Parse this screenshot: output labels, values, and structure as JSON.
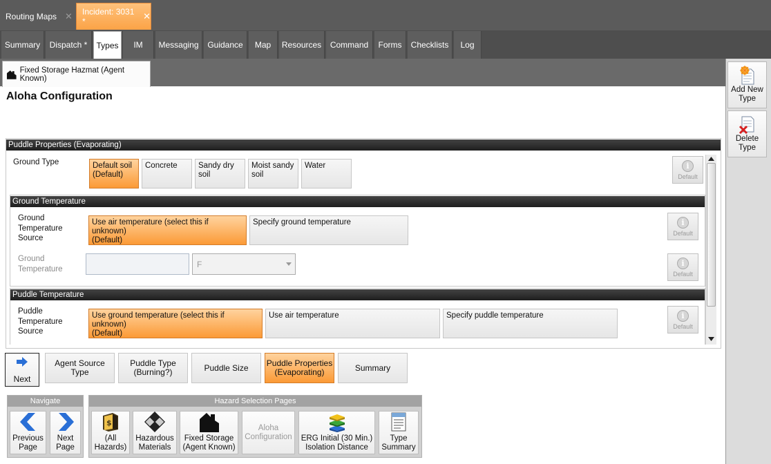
{
  "doc_tabs": [
    {
      "label": "Routing Maps",
      "close": "✕"
    },
    {
      "label": "Incident: 3031 *",
      "close": "✕"
    }
  ],
  "nav_tabs": [
    "Summary",
    "Dispatch *",
    "Types",
    "IM",
    "Messaging",
    "Guidance",
    "Map",
    "Resources",
    "Command",
    "Forms",
    "Checklists",
    "Log"
  ],
  "type_tab": {
    "label": "Fixed Storage Hazmat (Agent Known)",
    "icon": "building-icon"
  },
  "side_buttons": {
    "add": {
      "line1": "Add New",
      "line2": "Type"
    },
    "delete": {
      "line1": "Delete",
      "line2": "Type"
    }
  },
  "page_title": "Aloha Configuration",
  "puddle_section": {
    "header": "Puddle Properties (Evaporating)",
    "ground_type": {
      "label": "Ground Type",
      "options": [
        {
          "l1": "Default soil",
          "l2": "(Default)"
        },
        {
          "l1": "Concrete",
          "l2": ""
        },
        {
          "l1": "Sandy dry",
          "l2": "soil"
        },
        {
          "l1": "Moist sandy",
          "l2": "soil"
        },
        {
          "l1": "Water",
          "l2": ""
        }
      ],
      "default_label": "Default"
    }
  },
  "ground_temp_section": {
    "header": "Ground Temperature",
    "source": {
      "label_lines": [
        "Ground",
        "Temperature",
        "Source"
      ],
      "options": [
        {
          "l1": "Use air temperature (select this if unknown)",
          "l2": "(Default)"
        },
        {
          "l1": "Specify ground temperature",
          "l2": ""
        }
      ],
      "default_label": "Default"
    },
    "temperature": {
      "label_lines": [
        "Ground",
        "Temperature"
      ],
      "value": "",
      "unit": "F",
      "default_label": "Default"
    }
  },
  "puddle_temp_section": {
    "header": "Puddle Temperature",
    "source": {
      "label_lines": [
        "Puddle",
        "Temperature",
        "Source"
      ],
      "options": [
        {
          "l1": "Use ground temperature (select this if unknown)",
          "l2": "(Default)"
        },
        {
          "l1": "Use air temperature",
          "l2": ""
        },
        {
          "l1": "Specify puddle temperature",
          "l2": ""
        }
      ],
      "default_label": "Default"
    }
  },
  "wizard": {
    "next_label": "Next",
    "steps": [
      {
        "l1": "Agent Source Type",
        "l2": ""
      },
      {
        "l1": "Puddle Type",
        "l2": "(Burning?)"
      },
      {
        "l1": "Puddle Size",
        "l2": ""
      },
      {
        "l1": "Puddle Properties",
        "l2": "(Evaporating)"
      },
      {
        "l1": "Summary",
        "l2": ""
      }
    ]
  },
  "navigate_group": {
    "header": "Navigate",
    "previous": {
      "l1": "Previous",
      "l2": "Page"
    },
    "next": {
      "l1": "Next",
      "l2": "Page"
    }
  },
  "hazard_group": {
    "header": "Hazard Selection Pages",
    "buttons": [
      {
        "l1": "(All",
        "l2": "Hazards)"
      },
      {
        "l1": "Hazardous",
        "l2": "Materials"
      },
      {
        "l1": "Fixed Storage",
        "l2": "(Agent Known)"
      },
      {
        "l1": "Aloha",
        "l2": "Configuration"
      },
      {
        "l1": "ERG Initial (30 Min.)",
        "l2": "Isolation Distance"
      },
      {
        "l1": "Type",
        "l2": "Summary"
      }
    ]
  },
  "colors": {
    "accent": "#fba347",
    "selected_border": "#d37c2a",
    "tab_bar": "#5b5b5b"
  }
}
